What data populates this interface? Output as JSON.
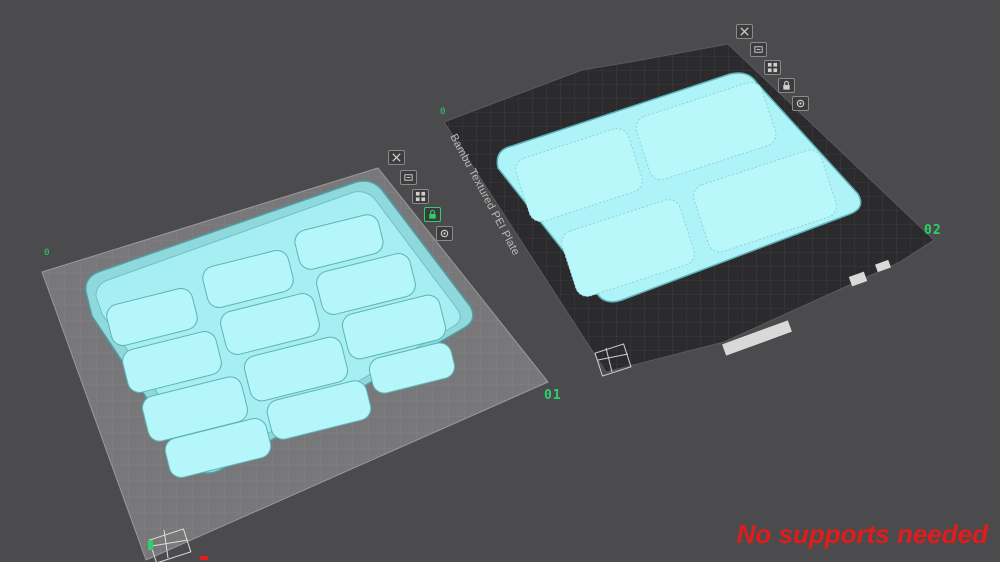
{
  "plates": [
    {
      "id": "01",
      "label": "01",
      "origin_marker": "0"
    },
    {
      "id": "02",
      "label": "02",
      "origin_marker": "0",
      "bed_name": "Bambu Textured PEI Plate"
    }
  ],
  "plate_tools": [
    "close-icon",
    "auto-orient-icon",
    "arrange-icon",
    "lock-icon",
    "settings-icon"
  ],
  "caption": "No supports needed",
  "colors": {
    "background": "#4b4b4d",
    "plate_light": "#7a7a7c",
    "plate_dark": "#2b2b2d",
    "model": "#aef3f7",
    "model_edge": "#5fb3b8",
    "plate_label": "#2fd06a",
    "caption": "#e21b1b"
  }
}
